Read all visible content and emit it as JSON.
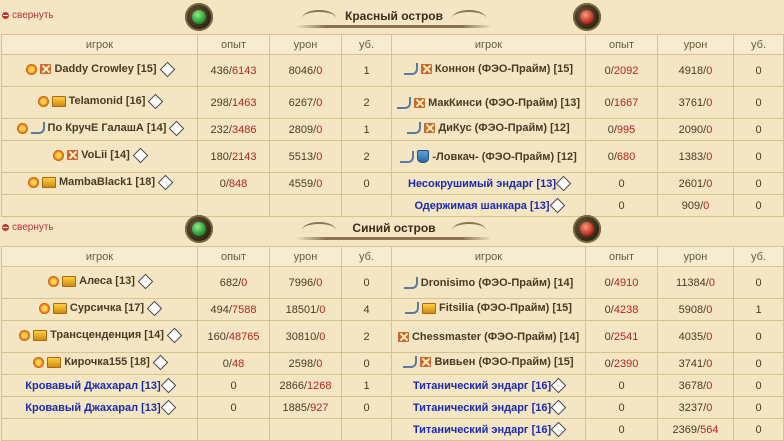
{
  "red": {
    "collapse_label": "свернуть",
    "title": "Красный остров",
    "headers": [
      "игрок",
      "опыт",
      "урон",
      "уб.",
      "игрок",
      "опыт",
      "урон",
      "уб."
    ],
    "rows": [
      {
        "l_name": "Daddy Crowley [15]",
        "l_exp_a": "436",
        "l_exp_b": "6143",
        "l_dmg_a": "8046",
        "l_dmg_b": "0",
        "l_kills": "1",
        "r_name": "Коннон (ФЭО-Прайм) [15]",
        "r_exp_a": "0",
        "r_exp_b": "2092",
        "r_dmg_a": "4918",
        "r_dmg_b": "0",
        "r_kills": "0"
      },
      {
        "l_name": "Telamonid [16]",
        "l_exp_a": "298",
        "l_exp_b": "1463",
        "l_dmg_a": "6267",
        "l_dmg_b": "0",
        "l_kills": "2",
        "r_name": "МакКинси (ФЭО-Прайм) [13]",
        "r_exp_a": "0",
        "r_exp_b": "1667",
        "r_dmg_a": "3761",
        "r_dmg_b": "0",
        "r_kills": "0"
      },
      {
        "l_name": "По КручЕ ГалашА [14]",
        "l_exp_a": "232",
        "l_exp_b": "3486",
        "l_dmg_a": "2809",
        "l_dmg_b": "0",
        "l_kills": "1",
        "r_name": "ДиКус (ФЭО-Прайм) [12]",
        "r_exp_a": "0",
        "r_exp_b": "995",
        "r_dmg_a": "2090",
        "r_dmg_b": "0",
        "r_kills": "0"
      },
      {
        "l_name": "VoLii [14]",
        "l_exp_a": "180",
        "l_exp_b": "2143",
        "l_dmg_a": "5513",
        "l_dmg_b": "0",
        "l_kills": "2",
        "r_name": "-Ловкач- (ФЭО-Прайм) [12]",
        "r_exp_a": "0",
        "r_exp_b": "680",
        "r_dmg_a": "1383",
        "r_dmg_b": "0",
        "r_kills": "0"
      },
      {
        "l_name": "MambaBlack1 [18]",
        "l_exp_a": "0",
        "l_exp_b": "848",
        "l_dmg_a": "4559",
        "l_dmg_b": "0",
        "l_kills": "0",
        "r_name": "Несокрушимый эндарг [13]",
        "r_exp": "0",
        "r_dmg_a": "2601",
        "r_dmg_b": "0",
        "r_kills": "0"
      },
      {
        "r_name": "Одержимая шанкара [13]",
        "r_exp": "0",
        "r_dmg_a": "909",
        "r_dmg_b": "0",
        "r_kills": "0"
      }
    ]
  },
  "blue": {
    "collapse_label": "свернуть",
    "title": "Синий остров",
    "headers": [
      "игрок",
      "опыт",
      "урон",
      "уб.",
      "игрок",
      "опыт",
      "урон",
      "уб."
    ],
    "rows": [
      {
        "l_name": "Алеса [13]",
        "l_exp_a": "682",
        "l_exp_b": "0",
        "l_dmg_a": "7996",
        "l_dmg_b": "0",
        "l_kills": "0",
        "r_name": "Dronisimo (ФЭО-Прайм) [14]",
        "r_exp_a": "0",
        "r_exp_b": "4910",
        "r_dmg_a": "11384",
        "r_dmg_b": "0",
        "r_kills": "0"
      },
      {
        "l_name": "Сурсичка [17]",
        "l_exp_a": "494",
        "l_exp_b": "7588",
        "l_dmg_a": "18501",
        "l_dmg_b": "0",
        "l_kills": "4",
        "r_name": "Fitsilia (ФЭО-Прайм) [15]",
        "r_exp_a": "0",
        "r_exp_b": "4238",
        "r_dmg_a": "5908",
        "r_dmg_b": "0",
        "r_kills": "1"
      },
      {
        "l_name": "Трансценденция [14]",
        "l_exp_a": "160",
        "l_exp_b": "48765",
        "l_dmg_a": "30810",
        "l_dmg_b": "0",
        "l_kills": "2",
        "r_name": "Chessmaster (ФЭО-Прайм) [14]",
        "r_exp_a": "0",
        "r_exp_b": "2541",
        "r_dmg_a": "4035",
        "r_dmg_b": "0",
        "r_kills": "0"
      },
      {
        "l_name": "Кирочка155 [18]",
        "l_exp_a": "0",
        "l_exp_b": "48",
        "l_dmg_a": "2598",
        "l_dmg_b": "0",
        "l_kills": "0",
        "r_name": "Вивьен (ФЭО-Прайм) [15]",
        "r_exp_a": "0",
        "r_exp_b": "2390",
        "r_dmg_a": "3741",
        "r_dmg_b": "0",
        "r_kills": "0"
      },
      {
        "l_name": "Кровавый Джахарал [13]",
        "l_exp": "0",
        "l_dmg_a": "2866",
        "l_dmg_b": "1268",
        "l_kills": "1",
        "r_name": "Титанический эндарг [16]",
        "r_exp": "0",
        "r_dmg_a": "3678",
        "r_dmg_b": "0",
        "r_kills": "0"
      },
      {
        "l_name": "Кровавый Джахарал [13]",
        "l_exp": "0",
        "l_dmg_a": "1885",
        "l_dmg_b": "927",
        "l_kills": "0",
        "r_name": "Титанический эндарг [16]",
        "r_exp": "0",
        "r_dmg_a": "3237",
        "r_dmg_b": "0",
        "r_kills": "0"
      },
      {
        "r_name": "Титанический эндарг [16]",
        "r_exp": "0",
        "r_dmg_a": "2369",
        "r_dmg_b": "564",
        "r_kills": "0"
      }
    ]
  }
}
